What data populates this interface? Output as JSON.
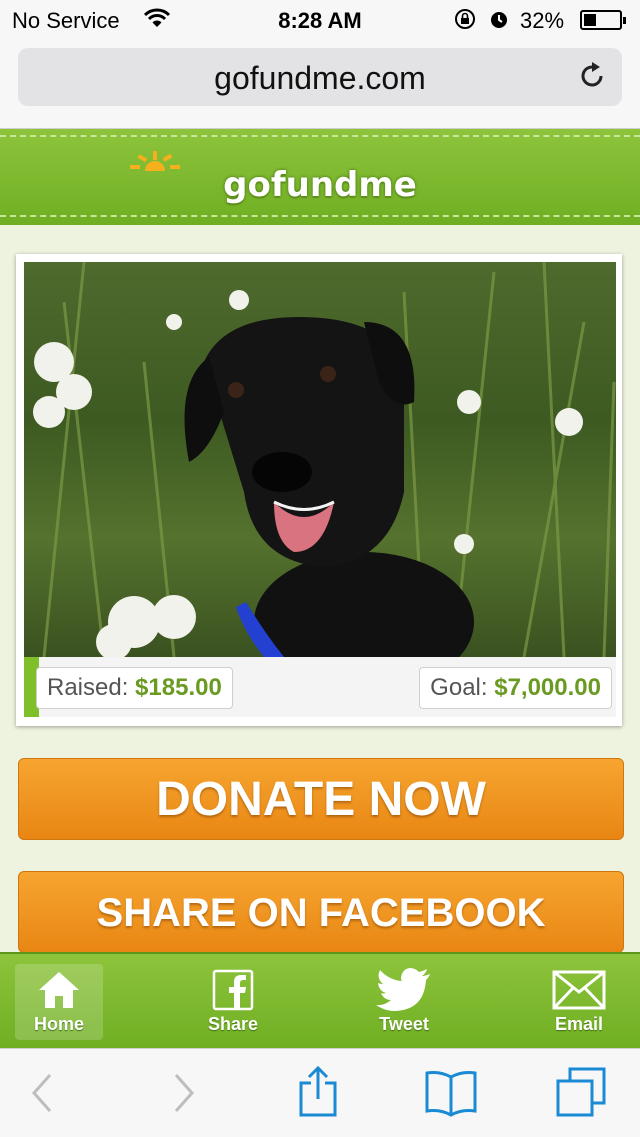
{
  "status_bar": {
    "carrier": "No Service",
    "time": "8:28 AM",
    "battery": "32%"
  },
  "browser": {
    "url": "gofundme.com"
  },
  "header": {
    "logo": "gofundme"
  },
  "campaign": {
    "photo_alt": "black dog in tall grass",
    "raised_label": "Raised:",
    "raised_value": "$185.00",
    "goal_label": "Goal:",
    "goal_value": "$7,000.00",
    "progress_fraction": 0.026
  },
  "actions": {
    "donate_label": "DONATE NOW",
    "share_facebook_label": "SHARE ON FACEBOOK"
  },
  "bottom_nav": {
    "items": [
      {
        "label": "Home",
        "icon": "home-icon"
      },
      {
        "label": "Share",
        "icon": "facebook-icon"
      },
      {
        "label": "Tweet",
        "icon": "twitter-bird-icon"
      },
      {
        "label": "Email",
        "icon": "envelope-icon"
      }
    ]
  },
  "colors": {
    "brand_green": "#7fb82e",
    "button_orange": "#f09a22",
    "safari_blue": "#1a8ad4"
  }
}
